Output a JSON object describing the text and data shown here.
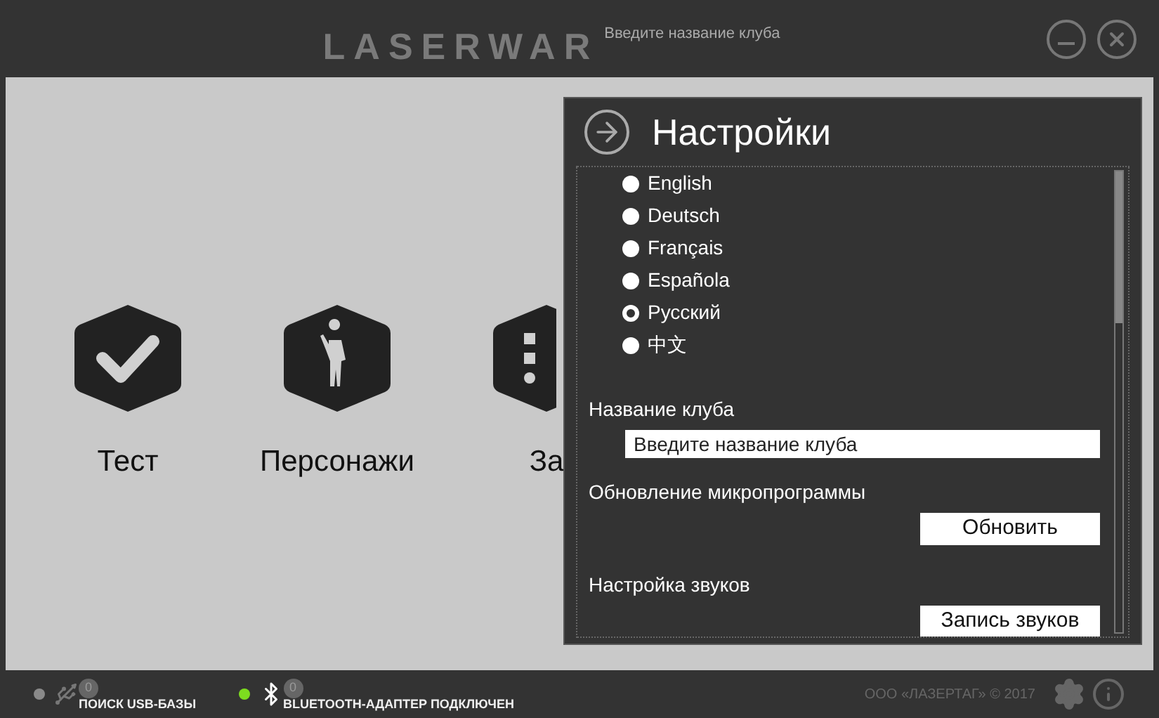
{
  "header": {
    "logo": "LASERWAR",
    "club_name": "Введите название клуба"
  },
  "tiles": [
    {
      "kind": "check",
      "label": "Тест"
    },
    {
      "kind": "soldier",
      "label": "Персонажи"
    },
    {
      "kind": "list",
      "label": "За"
    }
  ],
  "settings": {
    "title": "Настройки",
    "languages": [
      {
        "label": "English",
        "selected": false
      },
      {
        "label": "Deutsch",
        "selected": false
      },
      {
        "label": "Français",
        "selected": false
      },
      {
        "label": "Española",
        "selected": false
      },
      {
        "label": "Русский",
        "selected": true
      },
      {
        "label": "中文",
        "selected": false
      }
    ],
    "club_label": "Название клуба",
    "club_placeholder": "Введите название клуба",
    "firmware_label": "Обновление микропрограммы",
    "firmware_button": "Обновить",
    "sound_label": "Настройка звуков",
    "sound_button": "Запись звуков"
  },
  "status_bar": {
    "devices": [
      {
        "kind": "usb",
        "color": "#8a8a8a",
        "count": "0",
        "label": "ПОИСК USB-БАЗЫ"
      },
      {
        "kind": "bluetooth",
        "color": "#7ddc1f",
        "count": "0",
        "label": "BLUETOOTH-АДАПТЕР ПОДКЛЮЧЕН"
      }
    ],
    "copyright": "ООО «ЛАЗЕРТАГ» © 2017"
  }
}
